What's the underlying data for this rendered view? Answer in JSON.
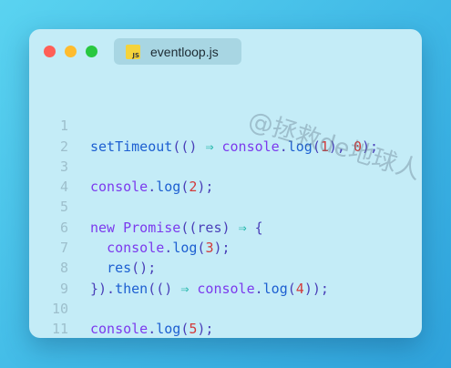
{
  "window": {
    "tab_title": "eventloop.js",
    "watermark": "@拯救de地球人",
    "colors": {
      "background": "#3fb8e6",
      "window": "#c4ecf7",
      "red": "#ff5f57",
      "yellow": "#febc2e",
      "green": "#28c840"
    },
    "icons": [
      "close-dot-icon",
      "minimize-dot-icon",
      "maximize-dot-icon",
      "js-file-icon"
    ]
  },
  "code": {
    "line_numbers": [
      "1",
      "2",
      "3",
      "4",
      "5",
      "6",
      "7",
      "8",
      "9",
      "10",
      "11"
    ],
    "lines": [
      "setTimeout(() ⇒ console.log(1), 0);",
      "",
      "console.log(2);",
      "",
      "new Promise((res) ⇒ {",
      "  console.log(3);",
      "  res();",
      "}).then(() ⇒ console.log(4));",
      "",
      "console.log(5);",
      ""
    ],
    "tokens": {
      "l1": [
        "setTimeout",
        "(() ",
        "⇒",
        " ",
        "console",
        ".",
        "log",
        "(",
        "1",
        "), ",
        "0",
        ");"
      ],
      "l3": [
        "console",
        ".",
        "log",
        "(",
        "2",
        ");"
      ],
      "l5": [
        "new",
        " ",
        "Promise",
        "((res) ",
        "⇒",
        " {"
      ],
      "l6": [
        "  ",
        "console",
        ".",
        "log",
        "(",
        "3",
        ");"
      ],
      "l7": [
        "  ",
        "res",
        "();"
      ],
      "l8": [
        "}).",
        "then",
        "(() ",
        "⇒",
        " ",
        "console",
        ".",
        "log",
        "(",
        "4",
        "));"
      ],
      "l10": [
        "console",
        ".",
        "log",
        "(",
        "5",
        ");"
      ]
    }
  }
}
